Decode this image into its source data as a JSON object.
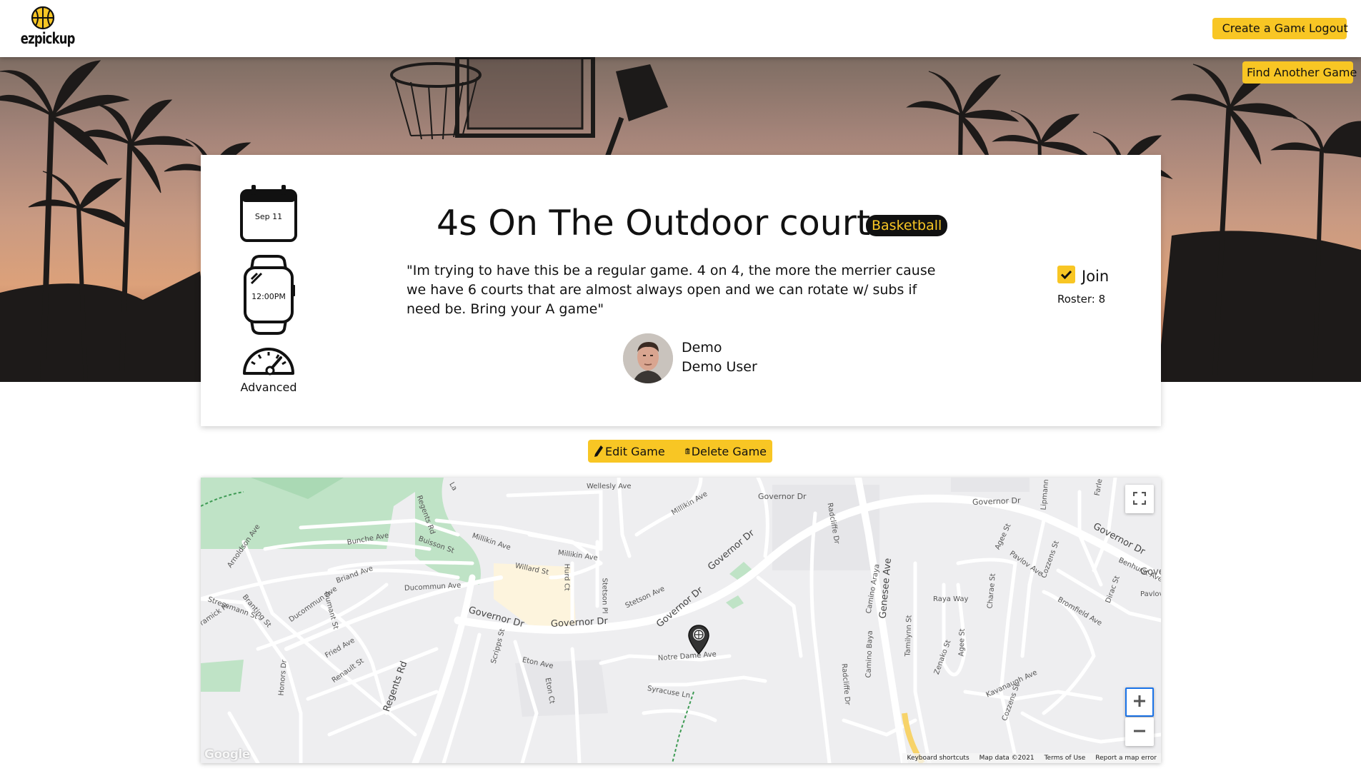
{
  "brand": {
    "name": "ezpickup"
  },
  "nav": {
    "create_label": "Create a Game",
    "logout_label": "Logout",
    "find_label": "Find Another Game"
  },
  "game": {
    "date": "Sep 11",
    "time": "12:00PM",
    "level": "Advanced",
    "title": "4s On The Outdoor court",
    "sport": "Basketball",
    "description": "\"Im trying to have this be a regular game. 4 on 4, the more the merrier cause we have 6 courts that are almost always open and we can rotate w/ subs if need be. Bring your A game\"",
    "organizer_username": "Demo",
    "organizer_fullname": "Demo User",
    "join_label": "Join",
    "join_checked": true,
    "roster": "Roster: 8"
  },
  "actions": {
    "edit_label": "Edit Game",
    "delete_label": "Delete Game"
  },
  "map": {
    "streets": [
      "Wellesly Ave",
      "Millikin Ave",
      "Governor Dr",
      "Governor Dr",
      "Governor Dr",
      "Governor Dr",
      "Bunche Ave",
      "Buisson St",
      "Millikin Ave",
      "Millikin Ave",
      "Radcliffe Dr",
      "Lipmann St",
      "Benhurst Ave",
      "Regents Rd",
      "Arnoldson Ave",
      "Briand Ave",
      "Ducommun Ave",
      "Willard St",
      "Hurd Ct",
      "Stetson Pl",
      "Stetson Ave",
      "Agee St",
      "Pavlov Ave",
      "Cozzens St",
      "Pavlov",
      "Gover",
      "Branting St",
      "Stresemann St",
      "Dumant St",
      "Ducommun Ave",
      "Governor Dr",
      "Governor Dr",
      "Raya Way",
      "Charae St",
      "Bromfield Ave",
      "Dirac St",
      "Camino Araya",
      "Genesee Ave",
      "Fried Ave",
      "Renault St",
      "Honors Dr",
      "Regents Rd",
      "Scripps St",
      "Eton Ave",
      "Eton Ct",
      "Notre Dame Ave",
      "Radcliffe Dr",
      "Syracuse Ln",
      "Camino Baya",
      "Tamilynn St",
      "Zenako St",
      "Agee St",
      "Kavanaugh Ave",
      "Cozzens St",
      "Governor Dr",
      "ramick Pl",
      "Farle",
      "La"
    ],
    "google": "Google",
    "keyboard": "Keyboard shortcuts",
    "map_data": "Map data ©2021",
    "terms": "Terms of Use",
    "report": "Report a map error"
  },
  "colors": {
    "accent": "#f8c624",
    "badge_bg": "#111111"
  },
  "icons": [
    "basketball-icon",
    "calendar-icon",
    "watch-icon",
    "speedometer-icon",
    "check-icon",
    "pencil-icon",
    "trash-icon",
    "fullscreen-icon",
    "plus-icon",
    "minus-icon",
    "map-pin-icon"
  ]
}
